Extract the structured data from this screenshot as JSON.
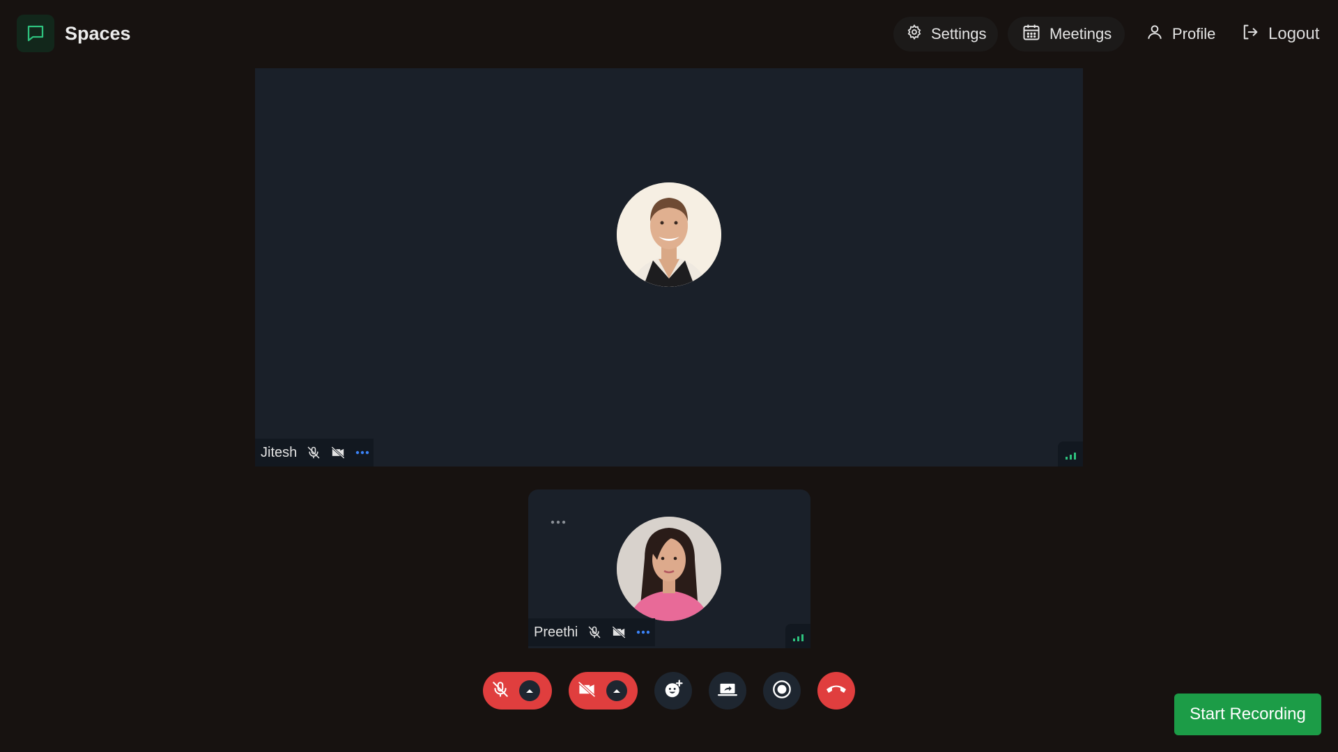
{
  "app": {
    "name": "Spaces"
  },
  "nav": {
    "settings": "Settings",
    "meetings": "Meetings",
    "profile": "Profile",
    "logout": "Logout"
  },
  "participants": [
    {
      "name": "Jitesh",
      "mic_muted": true,
      "camera_off": true,
      "signal": "good"
    },
    {
      "name": "Preethi",
      "mic_muted": true,
      "camera_off": true,
      "signal": "good"
    }
  ],
  "controls": {
    "mic": "mic-muted",
    "camera": "camera-off",
    "reactions": "emoji-add",
    "share": "screen-share",
    "record": "record",
    "leave": "leave-call"
  },
  "actions": {
    "start_recording": "Start Recording"
  },
  "colors": {
    "background": "#171210",
    "tile": "#1a2029",
    "danger": "#e03e3e",
    "success": "#1c9c47",
    "accent_blue": "#3b82f6",
    "signal": "#2ec27e"
  }
}
